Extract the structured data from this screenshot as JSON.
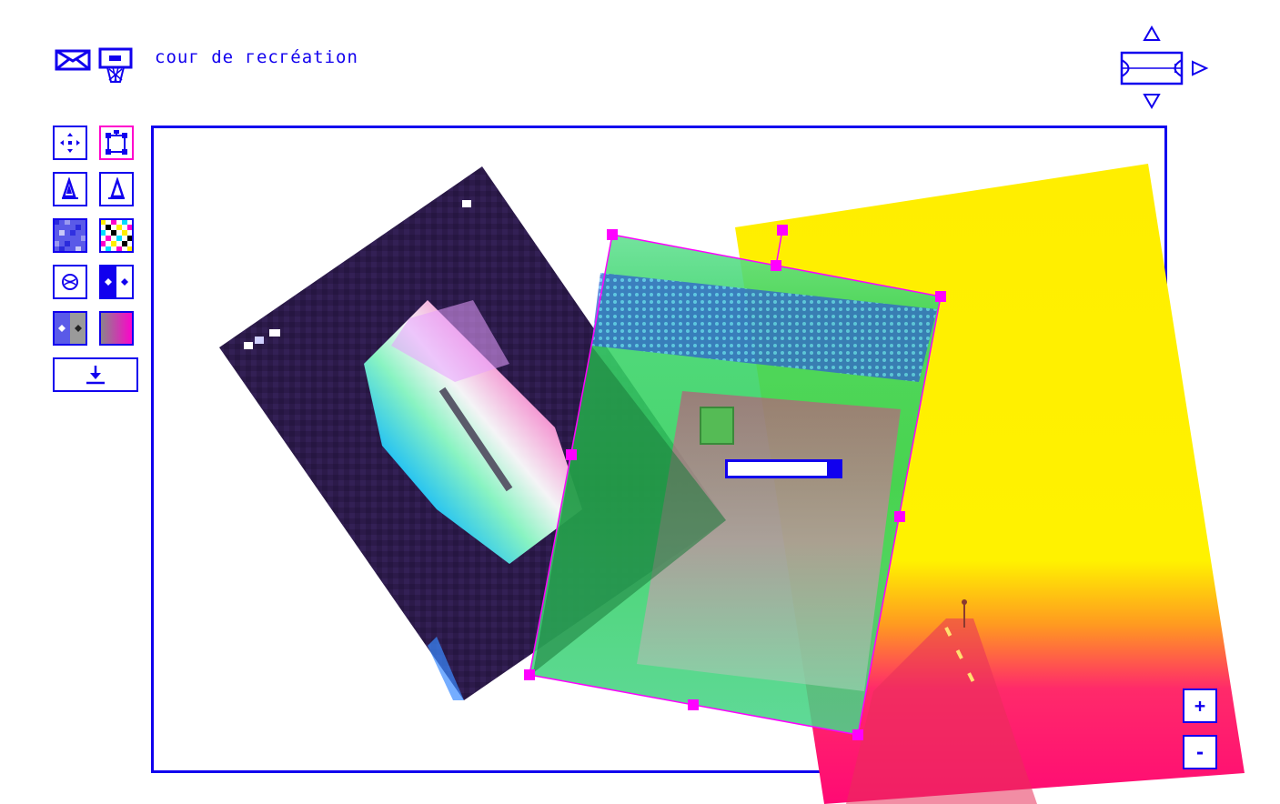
{
  "app": {
    "title": "couг de гecгéation"
  },
  "header": {
    "icons": [
      "envelope-icon",
      "basketball-hoop-icon"
    ]
  },
  "navigator": {
    "icons": [
      "arrow-up-icon",
      "arrow-right-icon",
      "arrow-down-icon",
      "court-icon"
    ]
  },
  "toolbar": {
    "tools": [
      {
        "name": "move-tool",
        "icon": "move-arrows-icon",
        "active": false
      },
      {
        "name": "transform-tool",
        "icon": "transform-frame-icon",
        "active": true
      },
      {
        "name": "skew-left-tool",
        "icon": "sail-icon",
        "active": false
      },
      {
        "name": "skew-right-tool",
        "icon": "sail-outline-icon",
        "active": false
      },
      {
        "name": "pixelate-tool",
        "icon": "blue-pixel-icon",
        "active": false
      },
      {
        "name": "color-noise-tool",
        "icon": "color-noise-icon",
        "active": false
      },
      {
        "name": "ball-tool",
        "icon": "ball-icon",
        "active": false
      },
      {
        "name": "contrast-tool",
        "icon": "contrast-split-icon",
        "active": false
      },
      {
        "name": "gradient-map-tool",
        "icon": "gradient-split-icon",
        "active": false
      },
      {
        "name": "gradient-tool",
        "icon": "gradient-swatch-icon",
        "active": false
      },
      {
        "name": "download-tool",
        "icon": "download-icon",
        "active": false
      }
    ]
  },
  "zoom": {
    "in_label": "+",
    "out_label": "-"
  },
  "colors": {
    "accent": "#1100ee",
    "selection": "#ff00ff",
    "background": "#ffffff"
  },
  "canvas": {
    "layers": [
      "pixelated-prism-image",
      "road-image-yellow-magenta",
      "court-image-green"
    ],
    "selected_layer": "court-image-green",
    "opacity_slider_value": 0.88
  }
}
